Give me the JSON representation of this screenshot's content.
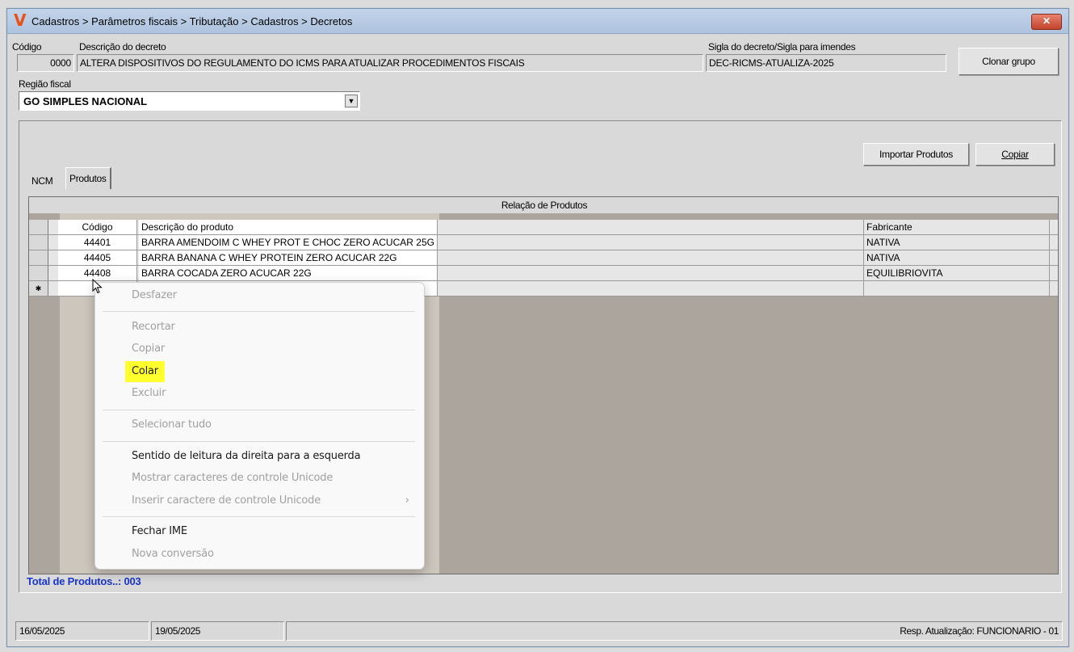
{
  "window": {
    "title": "Cadastros > Parâmetros fiscais > Tributação > Cadastros > Decretos",
    "logo": "V",
    "close": "✕"
  },
  "form": {
    "codigo_label": "Código",
    "codigo_value": "0000",
    "descricao_label": "Descrição do decreto",
    "descricao_value": "ALTERA DISPOSITIVOS DO REGULAMENTO DO ICMS PARA ATUALIZAR PROCEDIMENTOS FISCAIS",
    "sigla_label": "Sigla do decreto/Sigla para imendes",
    "sigla_value": "DEC-RICMS-ATUALIZA-2025",
    "clonar_button": "Clonar grupo",
    "regiao_label": "Região fiscal",
    "regiao_value": "GO SIMPLES NACIONAL"
  },
  "actions": {
    "importar": "Importar Produtos",
    "copiar": "Copiar"
  },
  "tabs": [
    {
      "label": "NCM"
    },
    {
      "label": "Produtos"
    }
  ],
  "grid": {
    "caption": "Relação de Produtos",
    "headers": {
      "code": "Código",
      "desc": "Descrição do produto",
      "manuf": "Fabricante"
    },
    "rows": [
      {
        "code": "44401",
        "desc": "BARRA AMENDOIM C WHEY PROT E CHOC ZERO ACUCAR 25G",
        "manuf": "NATIVA"
      },
      {
        "code": "44405",
        "desc": "BARRA BANANA C WHEY PROTEIN ZERO ACUCAR 22G",
        "manuf": "NATIVA"
      },
      {
        "code": "44408",
        "desc": "BARRA COCADA ZERO ACUCAR 22G",
        "manuf": "EQUILIBRIOVITA"
      }
    ],
    "new_row_marker": "✱"
  },
  "total": "Total de Produtos..: 003",
  "status": {
    "date1": "16/05/2025",
    "date2": "19/05/2025",
    "resp": "Resp. Atualização: FUNCIONARIO - 01"
  },
  "context_menu": {
    "items": [
      {
        "label": "Desfazer",
        "enabled": false
      },
      {
        "label": "Recortar",
        "enabled": false
      },
      {
        "label": "Copiar",
        "enabled": false
      },
      {
        "label": "Colar",
        "enabled": true,
        "highlighted": true
      },
      {
        "label": "Excluir",
        "enabled": false
      },
      {
        "label": "Selecionar tudo",
        "enabled": false
      },
      {
        "label": "Sentido de leitura da direita para a esquerda",
        "enabled": true
      },
      {
        "label": "Mostrar caracteres de controle Unicode",
        "enabled": false
      },
      {
        "label": "Inserir caractere de controle Unicode",
        "enabled": false,
        "submenu": "›"
      },
      {
        "label": "Fechar IME",
        "enabled": true
      },
      {
        "label": "Nova conversão",
        "enabled": false
      }
    ]
  },
  "colors": {
    "highlight": "#ffff2e",
    "total_text": "#1a35c9",
    "logo": "#e8511a"
  }
}
